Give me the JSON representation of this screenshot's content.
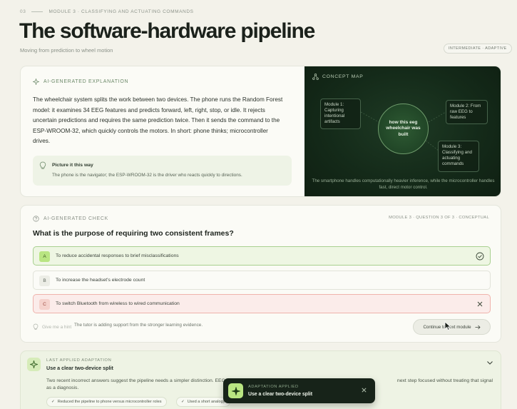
{
  "header": {
    "module_number": "03",
    "module_label": "MODULE 3 · CLASSIFYING AND ACTUATING COMMANDS",
    "title": "The software-hardware pipeline",
    "subtitle": "Moving from prediction to wheel motion",
    "level_badge": "INTERMEDIATE · ADAPTIVE"
  },
  "explanation": {
    "label": "AI-GENERATED EXPLANATION",
    "icon": "sparkle-icon",
    "body": "The wheelchair system splits the work between two devices. The phone runs the Random Forest model: it examines 34 EEG features and predicts forward, left, right, stop, or idle. It rejects uncertain predictions and requires the same prediction twice. Then it sends the command to the ESP-WROOM-32, which quickly controls the motors. In short: phone thinks; microcontroller drives.",
    "picture": {
      "title": "Picture it this way",
      "text": "The phone is the navigator; the ESP-WROOM-32 is the driver who reacts quickly to directions."
    }
  },
  "concept_map": {
    "label": "CONCEPT MAP",
    "hub": "how this eeg wheelchair was built",
    "nodes": [
      "Module 1: Capturing intentional artifacts",
      "Module 2: From raw EEG to features",
      "Module 3: Classifying and actuating commands"
    ],
    "caption": "The smartphone handles computationally heavier inference, while the microcontroller handles fast, direct motor control."
  },
  "check": {
    "label": "AI-GENERATED CHECK",
    "meta": "MODULE 3 · QUESTION 3 OF 3 · CONCEPTUAL",
    "question": "What is the purpose of requiring two consistent frames?",
    "options": [
      {
        "letter": "A",
        "text": "To reduce accidental responses to brief misclassifications",
        "state": "correct"
      },
      {
        "letter": "B",
        "text": "To increase the headset's electrode count",
        "state": "neutral"
      },
      {
        "letter": "C",
        "text": "To switch Bluetooth from wireless to wired communication",
        "state": "wrong"
      }
    ],
    "hint": "Give me a hint",
    "tutor_note": "The tutor is adding support from the stronger learning evidence.",
    "continue": "Continue to next module"
  },
  "adaptation": {
    "label": "LAST APPLIED ADAPTATION",
    "title": "Use a clear two-device split",
    "body_start": "Two recent incorrect answers suggest the pipeline needs a simpler distinction. EEG sh",
    "body_end": "next step focused without treating that signal as a diagnosis.",
    "chips": [
      "Reduced the pipeline to phone versus microcontroller roles",
      "Used a short analogy"
    ]
  },
  "toast": {
    "label": "ADAPTATION APPLIED",
    "text": "Use a clear two-device split"
  },
  "colors": {
    "accent": "#b9e582",
    "dark_panel": "#142a19",
    "correct": "#a8d08f",
    "wrong": "#efb3ac"
  }
}
